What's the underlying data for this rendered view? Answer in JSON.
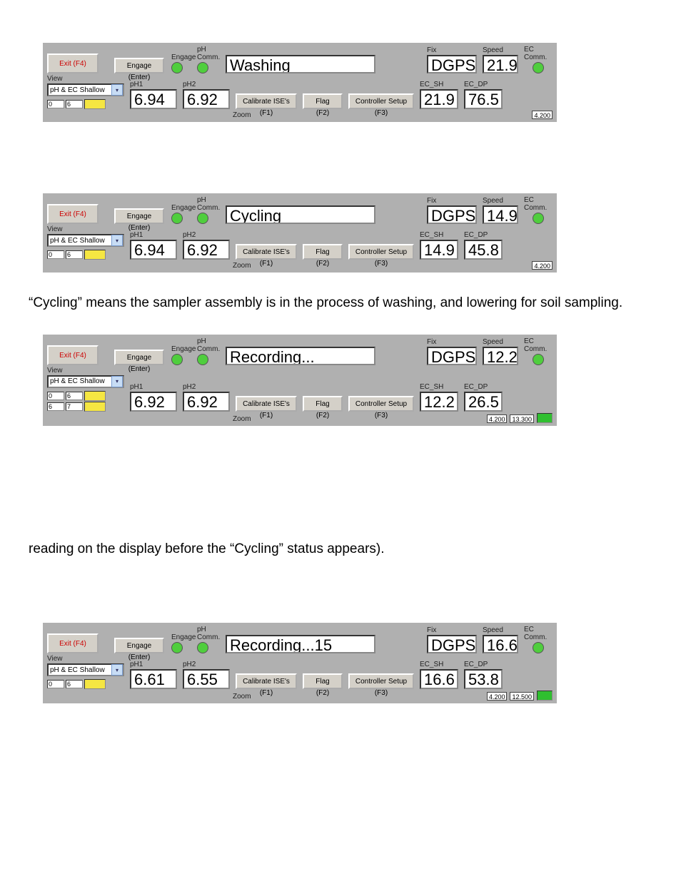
{
  "labels": {
    "exit": "Exit (F4)",
    "engageBtn": "Engage (Enter)",
    "engage": "Engage",
    "phcomm": "pH Comm.",
    "fix": "Fix",
    "speed": "Speed",
    "eccomm": "EC Comm.",
    "view": "View",
    "viewSel": "pH & EC Shallow",
    "ph1": "pH1",
    "ph2": "pH2",
    "calib": "Calibrate ISE's (F1)",
    "flag": "Flag (F2)",
    "ctrl": "Controller Setup (F3)",
    "ecsh": "EC_SH",
    "ecdp": "EC_DP",
    "zoom": "Zoom",
    "mini0": "0",
    "mini6": "6",
    "mini7": "7"
  },
  "panels": [
    {
      "status": "Washing",
      "fix": "DGPS",
      "speed": "21.9",
      "ph1": "6.94",
      "ph2": "6.92",
      "ecsh": "21.9",
      "ecdp": "76.5",
      "tail": [
        "4.200"
      ],
      "extra": false,
      "greenTail": false
    },
    {
      "status": "Cycling",
      "fix": "DGPS",
      "speed": "14.9",
      "ph1": "6.94",
      "ph2": "6.92",
      "ecsh": "14.9",
      "ecdp": "45.8",
      "tail": [
        "4.200"
      ],
      "extra": false,
      "greenTail": false
    },
    {
      "status": "Recording...",
      "fix": "DGPS",
      "speed": "12.2",
      "ph1": "6.92",
      "ph2": "6.92",
      "ecsh": "12.2",
      "ecdp": "26.5",
      "tail": [
        "4.200",
        "13.300"
      ],
      "extra": true,
      "greenTail": true
    },
    {
      "status": "Recording...15",
      "fix": "DGPS",
      "speed": "16.6",
      "ph1": "6.61",
      "ph2": "6.55",
      "ecsh": "16.6",
      "ecdp": "53.8",
      "tail": [
        "4.200",
        "12.500"
      ],
      "extra": false,
      "greenTail": true
    }
  ],
  "text": {
    "p1": "“Cycling” means the sampler assembly is in the process of washing, and lowering for soil sampling.",
    "p2": "reading on the display before the “Cycling” status appears)."
  },
  "gaps": [
    "60px",
    "40px",
    "110px"
  ]
}
